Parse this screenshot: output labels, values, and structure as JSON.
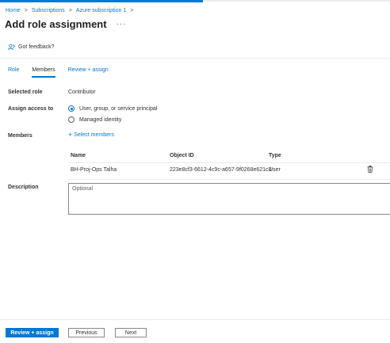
{
  "breadcrumb": {
    "items": [
      "Home",
      "Subscriptions",
      "Azure subscription 1"
    ],
    "separator": ">"
  },
  "header": {
    "title": "Add role assignment",
    "more": "···"
  },
  "feedback": {
    "label": "Got feedback?"
  },
  "tabs": [
    {
      "label": "Role"
    },
    {
      "label": "Members",
      "active": true
    },
    {
      "label": "Review + assign"
    }
  ],
  "form": {
    "selected_role": {
      "label": "Selected role",
      "value": "Contributor"
    },
    "assign_access": {
      "label": "Assign access to",
      "options": [
        {
          "label": "User, group, or service principal",
          "checked": true
        },
        {
          "label": "Managed identity",
          "checked": false
        }
      ]
    },
    "members": {
      "label": "Members",
      "select_link": "Select members",
      "plus": "+"
    },
    "table": {
      "columns": [
        "Name",
        "Object ID",
        "Type"
      ],
      "rows": [
        {
          "name": "BH-Proj-Ops Talha",
          "object_id": "223e8cf3-6612-4c9c-a657-9f0268e621c3",
          "type": "User"
        }
      ]
    },
    "description": {
      "label": "Description",
      "placeholder": "Optional",
      "value": ""
    }
  },
  "footer": {
    "review_assign": "Review + assign",
    "previous": "Previous",
    "next": "Next"
  },
  "colors": {
    "accent": "#0078d4",
    "text": "#323130",
    "border": "#8a8886"
  },
  "icons": {
    "feedback": "feedback-person-icon",
    "delete": "trash-icon",
    "add": "plus-icon"
  }
}
